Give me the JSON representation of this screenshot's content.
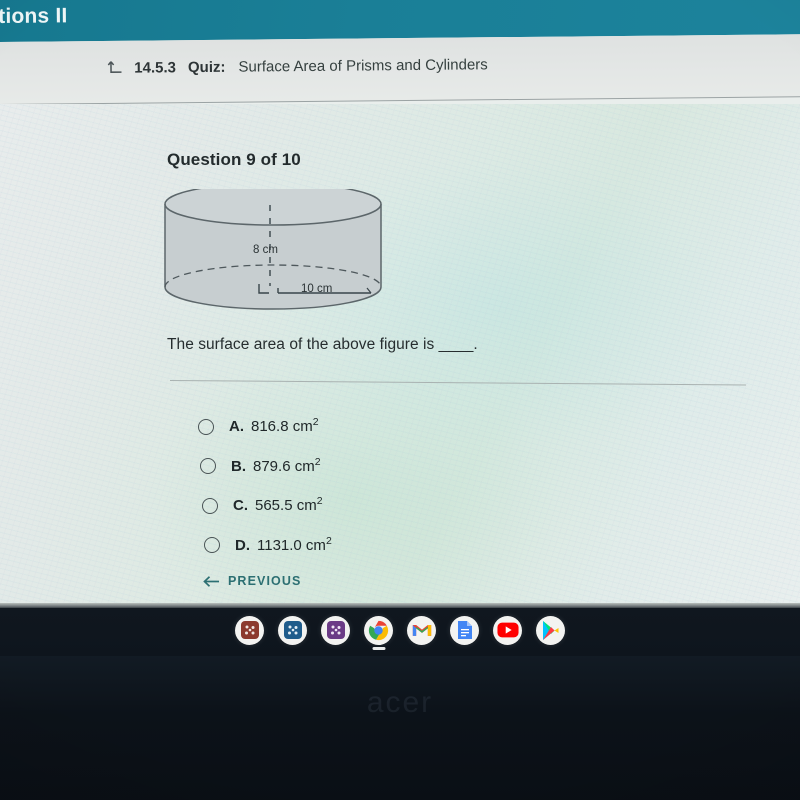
{
  "app_header": {
    "title": "tions II",
    "background_color": "#1a7f97"
  },
  "titlebar": {
    "return_icon": "return-arrow-icon",
    "quiz_number": "14.5.3",
    "quiz_word": "Quiz:",
    "quiz_name": "Surface Area of Prisms and Cylinders"
  },
  "question": {
    "counter": "Question 9 of 10",
    "prompt": "The surface area of the above figure is ____.",
    "figure": {
      "type": "cylinder",
      "height_label": "8 cm",
      "radius_label": "10 cm",
      "fill_color": "#c5ccce",
      "stroke_color": "#5a6468"
    },
    "options": [
      {
        "letter": "A.",
        "value": "816.8 cm",
        "exponent": "2",
        "selected": false
      },
      {
        "letter": "B.",
        "value": "879.6 cm",
        "exponent": "2",
        "selected": false
      },
      {
        "letter": "C.",
        "value": "565.5 cm",
        "exponent": "2",
        "selected": false
      },
      {
        "letter": "D.",
        "value": "1131.0 cm",
        "exponent": "2",
        "selected": false
      }
    ]
  },
  "navigation": {
    "previous_label": "PREVIOUS",
    "previous_icon": "arrow-left-icon",
    "accent_color": "#2c6f72"
  },
  "shelf": {
    "apps": [
      {
        "name": "app-red-icon",
        "color": "#8c3a2e"
      },
      {
        "name": "app-blue-icon",
        "color": "#1f5c8b"
      },
      {
        "name": "app-purple-icon",
        "color": "#6b3b86"
      },
      {
        "name": "chrome-icon",
        "color": "#4285f4"
      },
      {
        "name": "gmail-icon",
        "color": "#ea4335"
      },
      {
        "name": "google-docs-icon",
        "color": "#4285f4"
      },
      {
        "name": "youtube-icon",
        "color": "#ff0000"
      },
      {
        "name": "play-store-icon",
        "color": "#00a0ff"
      }
    ]
  },
  "device": {
    "brand": "acer"
  }
}
